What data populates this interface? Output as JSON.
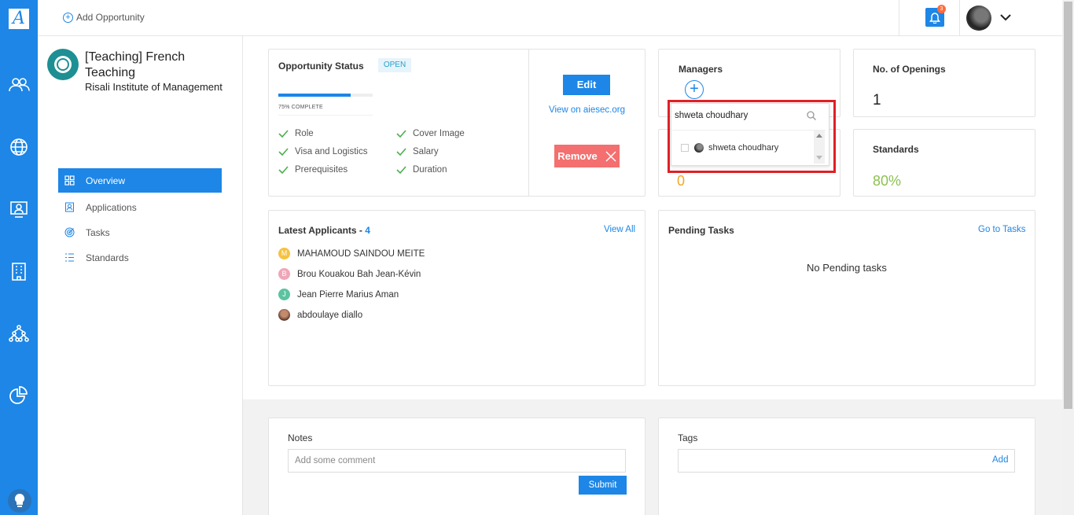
{
  "app": {
    "logo_letter": "A"
  },
  "topbar": {
    "add_opportunity": "Add Opportunity",
    "notification_count": "3"
  },
  "opportunity": {
    "title": "[Teaching] French Teaching",
    "organization": "Risali Institute of Management"
  },
  "nav": {
    "items": [
      {
        "label": "Overview",
        "icon": "grid-icon",
        "active": true
      },
      {
        "label": "Applications",
        "icon": "person-icon",
        "active": false
      },
      {
        "label": "Tasks",
        "icon": "target-icon",
        "active": false
      },
      {
        "label": "Standards",
        "icon": "list-icon",
        "active": false
      }
    ]
  },
  "status": {
    "title": "Opportunity Status",
    "badge": "OPEN",
    "progress_percent": 75,
    "progress_label": "75% COMPLETE",
    "checks_left": [
      "Role",
      "Visa and Logistics",
      "Prerequisites"
    ],
    "checks_right": [
      "Cover Image",
      "Salary",
      "Duration"
    ],
    "edit_label": "Edit",
    "view_link": "View on aiesec.org",
    "remove_label": "Remove"
  },
  "managers": {
    "title": "Managers",
    "search_value": "shweta choudhary",
    "results": [
      "shweta choudhary"
    ]
  },
  "openings": {
    "title": "No. of Openings",
    "value": "1"
  },
  "card2": {
    "value": "0"
  },
  "standards": {
    "title": "Standards",
    "value": "80%"
  },
  "applicants": {
    "title": "Latest Applicants - ",
    "count": "4",
    "view_all": "View All",
    "list": [
      {
        "initial": "M",
        "name": "MAHAMOUD SAINDOU MEITE",
        "color": "#f5c242"
      },
      {
        "initial": "B",
        "name": "Brou Kouakou Bah Jean-Kévin",
        "color": "#f0a6b8"
      },
      {
        "initial": "J",
        "name": "Jean Pierre Marius Aman",
        "color": "#5cc3a0"
      },
      {
        "initial": "",
        "name": "abdoulaye diallo",
        "color": "#8a5a44"
      }
    ]
  },
  "tasks": {
    "title": "Pending Tasks",
    "go_link": "Go to Tasks",
    "empty": "No Pending tasks"
  },
  "notes": {
    "title": "Notes",
    "placeholder": "Add some comment",
    "submit": "Submit"
  },
  "tags": {
    "title": "Tags",
    "add": "Add"
  },
  "colors": {
    "primary": "#1d86e6",
    "remove": "#f46f6f",
    "warning": "#f5a623",
    "success": "#8cc152",
    "highlight": "#e01f26"
  }
}
